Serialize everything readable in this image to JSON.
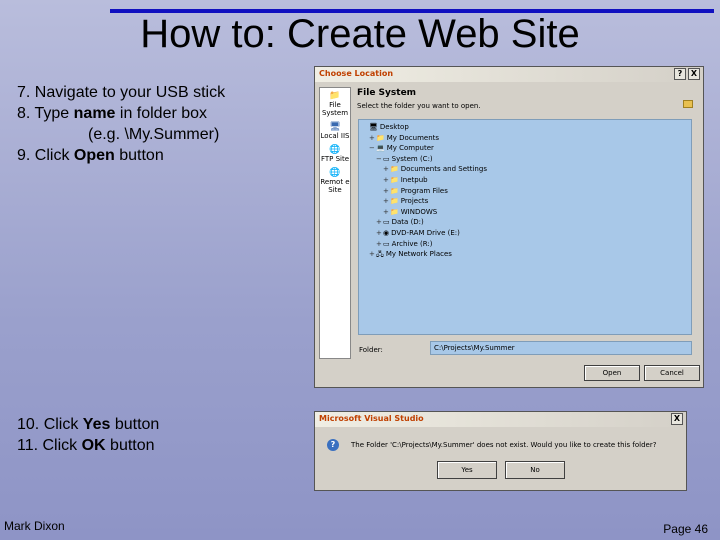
{
  "slide": {
    "title": "How to: Create Web Site",
    "steps_a": [
      "7. Navigate to your USB stick",
      "8. Type ",
      "name",
      " in folder box",
      "(e.g. \\My.Summer)",
      "9. Click ",
      "Open",
      " button"
    ],
    "steps_b": [
      "10. Click ",
      "Yes",
      " button",
      "11. Click ",
      "OK",
      " button"
    ],
    "footer_left": "Mark Dixon",
    "footer_right": "Page 46"
  },
  "choose_location": {
    "title": "Choose Location",
    "help_btn": "?",
    "close_btn": "X",
    "sidebar": [
      {
        "label": "File System",
        "icon": "folder-icon"
      },
      {
        "label": "Local IIS",
        "icon": "computer-icon"
      },
      {
        "label": "FTP Site",
        "icon": "globe-icon"
      },
      {
        "label": "Remot e Site",
        "icon": "globe-icon"
      }
    ],
    "header": "File System",
    "subheader": "Select the folder you want to open.",
    "tree": [
      {
        "indent": 0,
        "pm": "",
        "icon": "desktop-icon",
        "label": "Desktop"
      },
      {
        "indent": 1,
        "pm": "+",
        "icon": "folder-icon",
        "label": "My Documents"
      },
      {
        "indent": 1,
        "pm": "−",
        "icon": "computer-icon",
        "label": "My Computer"
      },
      {
        "indent": 2,
        "pm": "−",
        "icon": "drive-icon",
        "label": "System (C:)"
      },
      {
        "indent": 3,
        "pm": "+",
        "icon": "folder-icon",
        "label": "Documents and Settings"
      },
      {
        "indent": 3,
        "pm": "+",
        "icon": "folder-icon",
        "label": "Inetpub"
      },
      {
        "indent": 3,
        "pm": "+",
        "icon": "folder-icon",
        "label": "Program Files"
      },
      {
        "indent": 3,
        "pm": "+",
        "icon": "folder-icon",
        "label": "Projects"
      },
      {
        "indent": 3,
        "pm": "+",
        "icon": "folder-icon",
        "label": "WINDOWS"
      },
      {
        "indent": 2,
        "pm": "+",
        "icon": "drive-icon",
        "label": "Data (D:)"
      },
      {
        "indent": 2,
        "pm": "+",
        "icon": "disc-icon",
        "label": "DVD-RAM Drive (E:)"
      },
      {
        "indent": 2,
        "pm": "+",
        "icon": "drive-icon",
        "label": "Archive (R:)"
      },
      {
        "indent": 1,
        "pm": "+",
        "icon": "network-icon",
        "label": "My Network Places"
      }
    ],
    "folder_label": "Folder:",
    "folder_value": "C:\\Projects\\My.Summer",
    "open_btn": "Open",
    "cancel_btn": "Cancel"
  },
  "vs_dialog": {
    "title": "Microsoft Visual Studio",
    "close_btn": "X",
    "icon": "question-icon",
    "message": "The Folder 'C:\\Projects\\My.Summer' does not exist. Would you like to create this folder?",
    "yes_btn": "Yes",
    "no_btn": "No"
  }
}
